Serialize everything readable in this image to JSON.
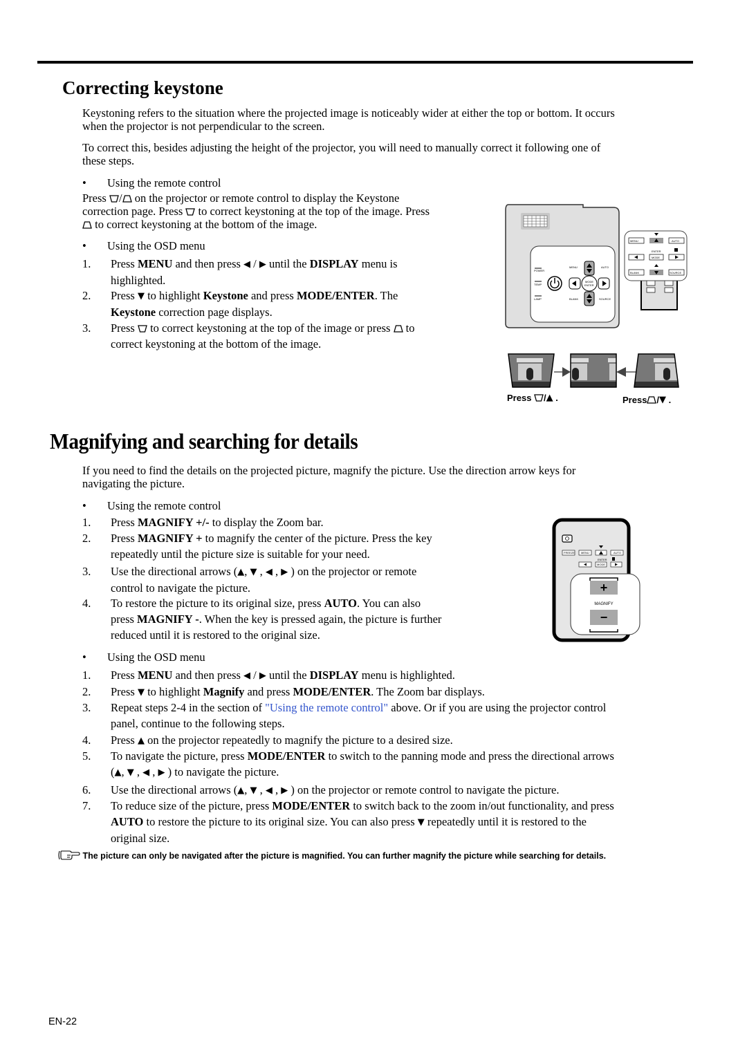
{
  "section1": {
    "title": "Correcting keystone",
    "intro1_line1": "Keystoning refers to the situation where the projected image is noticeably wider at either the top or bottom. It occurs",
    "intro1_line2": "when the projector is not perpendicular to the screen.",
    "intro2_line1": "To correct this, besides adjusting the height of the projector, you will need to manually correct it following one of",
    "intro2_line2": "these steps.",
    "bullet_remote": "Using the remote control",
    "remote_line1_pre": "Press",
    "remote_line1_post": "on the projector or remote control to display the Keystone",
    "remote_line2_pre": "correction page. Press",
    "remote_line2_post": "to correct keystoning at the top of the image. Press",
    "remote_line3_post": "to correct keystoning at the bottom of the image.",
    "bullet_osd": "Using the OSD menu",
    "steps": [
      {
        "num": "1.",
        "a": "Press ",
        "b1": "MENU",
        "c": " and then press ",
        "d": " until the ",
        "b2": "DISPLAY",
        "e": " menu is",
        "line2": "highlighted."
      },
      {
        "num": "2.",
        "a": "Press ",
        "c": " to highlight ",
        "b1": "Keystone",
        "d": " and press ",
        "b2": "MODE/ENTER",
        "e": ". The",
        "line2_bold": "Keystone",
        "line2": " correction page displays."
      },
      {
        "num": "3.",
        "a": " Press ",
        "c": " to correct keystoning at the top of the image or press ",
        "d": " to",
        "line2": "correct keystoning at the bottom of the image."
      }
    ],
    "figure": {
      "panel_labels": [
        "POWER",
        "TEMP",
        "LAMP",
        "MENU",
        "AUTO",
        "MODE",
        "ENTER",
        "BLANK",
        "SOURCE"
      ],
      "remote_labels": [
        "MENU",
        "AUTO",
        "ENTER",
        "MODE",
        "BLANK",
        "SOURCE"
      ],
      "caption_left": "Press",
      "caption_right": "Press"
    }
  },
  "section2": {
    "title": "Magnifying and searching for details",
    "intro_line1": "If you need to find the details on the projected picture, magnify the picture. Use the direction arrow keys for",
    "intro_line2": "navigating the picture.",
    "bullet_remote": "Using the remote control",
    "remote_steps": [
      {
        "num": "1.",
        "a": "Press ",
        "b1": "MAGNIFY +/-",
        "c": " to display the Zoom bar."
      },
      {
        "num": "2.",
        "a": "Press ",
        "b1": "MAGNIFY +",
        "c": " to magnify the center of the picture. Press the key",
        "line2": "repeatedly until the picture size is suitable for your need."
      },
      {
        "num": "3.",
        "a": "Use the directional arrows (",
        "c": ") on the projector or remote",
        "line2": "control to navigate the picture."
      },
      {
        "num": "4.",
        "a": "To restore the picture to its original size, press ",
        "b1": "AUTO",
        "c": ". You can also",
        "line2_pre": "press ",
        "line2_bold": "MAGNIFY -",
        "line2": ". When the key is pressed again, the picture is further",
        "line3": "reduced until it is restored to the original size."
      }
    ],
    "bullet_osd": "Using the OSD menu",
    "osd_steps": [
      {
        "num": "1.",
        "a": "Press ",
        "b1": "MENU",
        "c": " and then press ",
        "d": " until the ",
        "b2": "DISPLAY",
        "e": " menu is highlighted."
      },
      {
        "num": "2.",
        "a": "Press ",
        "c": " to highlight ",
        "b1": "Magnify",
        "d": " and press ",
        "b2": "MODE/ENTER",
        "e": ". The Zoom bar displays."
      },
      {
        "num": "3.",
        "a": "Repeat steps 2-4 in the section of ",
        "link": "\"Using the remote control\"",
        "c": " above. Or if you are using the projector control",
        "line2": "panel, continue to the following steps."
      },
      {
        "num": "4.",
        "a": "Press ",
        "c": " on the projector repeatedly to magnify the picture to a desired size."
      },
      {
        "num": "5.",
        "a": "To navigate the picture, press ",
        "b1": "MODE/ENTER",
        "c": " to switch to the panning mode and press the directional arrows",
        "line2_pre": "(",
        "line2": ") to navigate the picture."
      },
      {
        "num": "6.",
        "a": "Use the directional arrows (",
        "c": ") on the projector or remote control to navigate the picture."
      },
      {
        "num": "7.",
        "a": "To reduce size of the picture, press ",
        "b1": "MODE/ENTER",
        "c": " to switch back to the zoom in/out functionality, and press",
        "line2_bold": "AUTO",
        "line2": " to restore the picture to its original size. You can also press ",
        "line2_post": " repeatedly until it is restored to the",
        "line3": "original size."
      }
    ],
    "figure": {
      "remote_labels": [
        "FREEZE",
        "MENU",
        "AUTO",
        "ENTER",
        "MODE"
      ],
      "magnify_label": "MAGNIFY",
      "plus": "+",
      "minus": "−"
    },
    "note": "The picture can only be navigated after the picture is magnified. You can further magnify the picture while searching for details."
  },
  "glyphs": {
    "up": "▲",
    "down": "▼",
    "left": "◀",
    "right": "▶",
    "slash": "/",
    "sep": " ,",
    "comma": ", ",
    "arrows_sep": " / ",
    "period": ".",
    "bullet": "•"
  },
  "footer": {
    "page_number": "EN-22"
  }
}
